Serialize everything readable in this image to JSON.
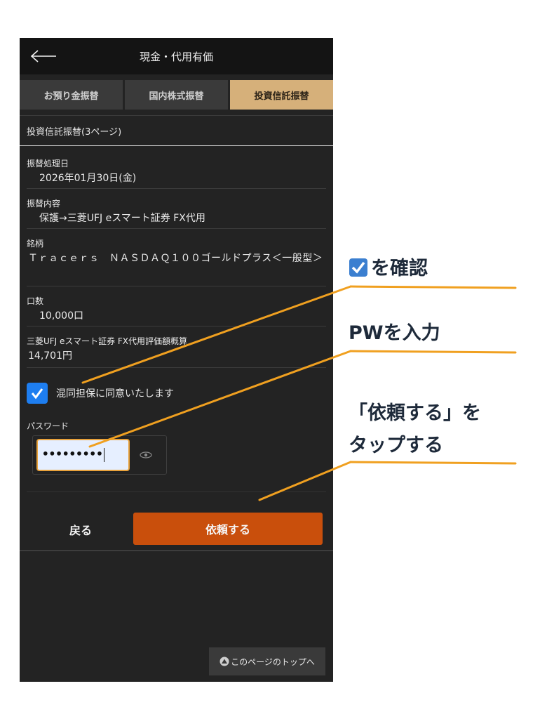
{
  "header": {
    "title": "現金・代用有価"
  },
  "tabs": [
    {
      "label": "お預り金振替",
      "active": false
    },
    {
      "label": "国内株式振替",
      "active": false
    },
    {
      "label": "投資信託振替",
      "active": true
    }
  ],
  "page_label": "投資信託振替(3ページ)",
  "fields": [
    {
      "label": "振替処理日",
      "value": "2026年01月30日(金)"
    },
    {
      "label": "振替内容",
      "value": "保護→三菱UFJ eスマート証券 FX代用"
    },
    {
      "label": "銘柄",
      "value": "Ｔｒａｃｅｒｓ　ＮＡＳＤＡＱ１００ゴールドプラス＜一般型＞"
    },
    {
      "label": "口数",
      "value": "10,000口"
    },
    {
      "label": "三菱UFJ eスマート証券 FX代用評価額概算",
      "value": "14,701円"
    }
  ],
  "consent": {
    "label": "混同担保に同意いたします",
    "checked": true
  },
  "password": {
    "label": "パスワード",
    "masked_value": "•••••••••"
  },
  "buttons": {
    "back": "戻る",
    "submit": "依頼する"
  },
  "top_link": "このページのトップへ",
  "annotations": {
    "check": "を確認",
    "password": "PWを入力",
    "submit_line1": "「依頼する」を",
    "submit_line2": "タップする"
  },
  "colors": {
    "active_tab": "#d6b07a",
    "submit_button": "#c94f0c",
    "checkbox": "#1e7ef0",
    "annotation_line": "#f0a020"
  }
}
